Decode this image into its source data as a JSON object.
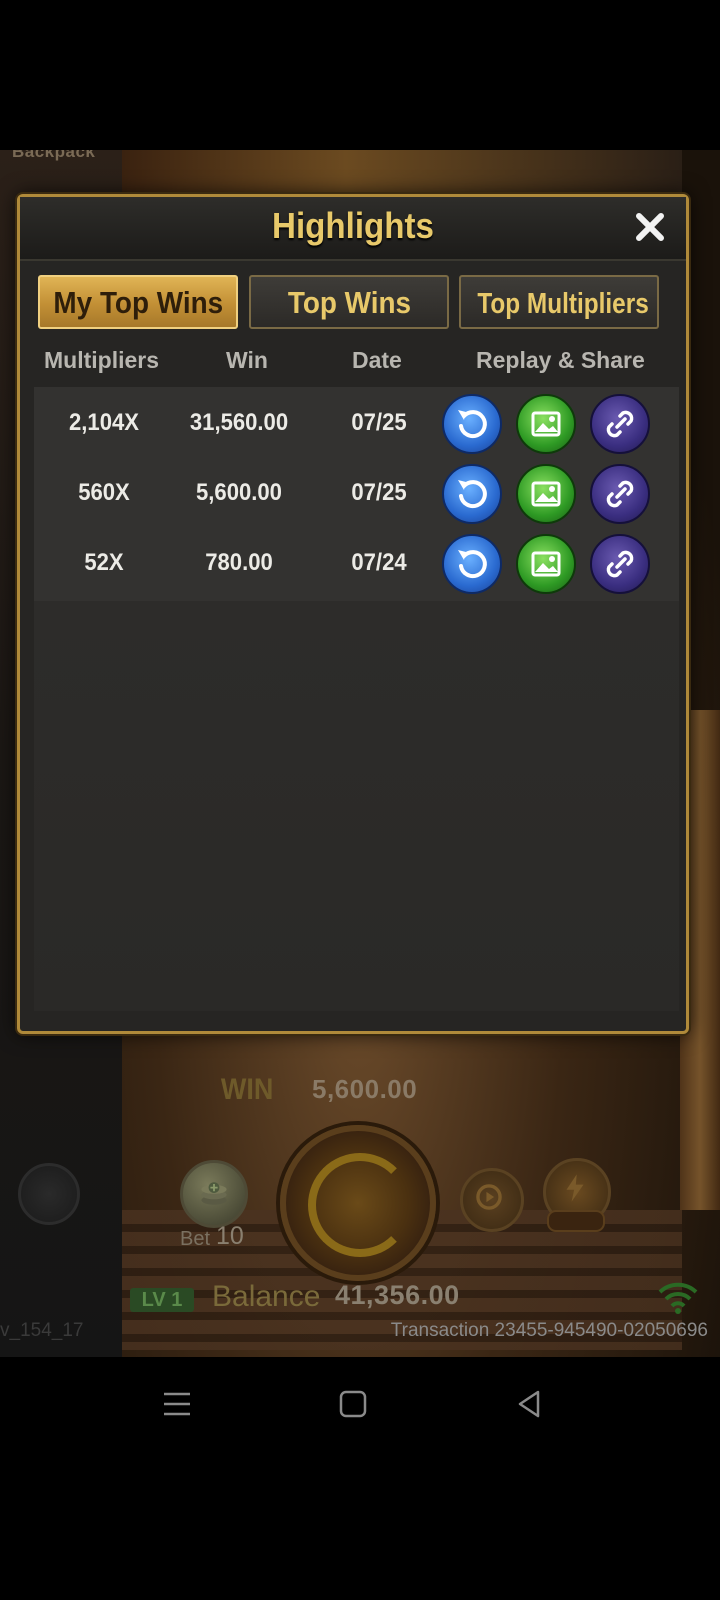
{
  "game": {
    "backpack_label": "Backpack",
    "win_label": "WIN",
    "win_value": "5,600.00",
    "bet_label": "Bet",
    "bet_value": "10",
    "level_badge": "LV 1",
    "balance_label": "Balance",
    "balance_value": "41,356.00",
    "transaction": "Transaction 23455-945490-02050696",
    "left_code": "v_154_17"
  },
  "dialog": {
    "title": "Highlights",
    "tabs": [
      {
        "label": "My Top Wins",
        "active": true
      },
      {
        "label": "Top Wins",
        "active": false
      },
      {
        "label": "Top Multipliers",
        "active": false
      }
    ],
    "columns": {
      "multipliers": "Multipliers",
      "win": "Win",
      "date": "Date",
      "replay_share": "Replay & Share"
    },
    "rows": [
      {
        "multiplier": "2,104X",
        "win": "31,560.00",
        "date": "07/25"
      },
      {
        "multiplier": "560X",
        "win": "5,600.00",
        "date": "07/25"
      },
      {
        "multiplier": "52X",
        "win": "780.00",
        "date": "07/24"
      }
    ]
  },
  "colors": {
    "gold_accent": "#e8c96a",
    "dialog_border": "#b08a3a",
    "replay_blue": "#2a6ad0",
    "image_green": "#2e9a24",
    "link_purple": "#3a2e80"
  },
  "icons": {
    "close": "close-icon",
    "replay": "replay-icon",
    "image": "image-icon",
    "link": "link-icon"
  }
}
